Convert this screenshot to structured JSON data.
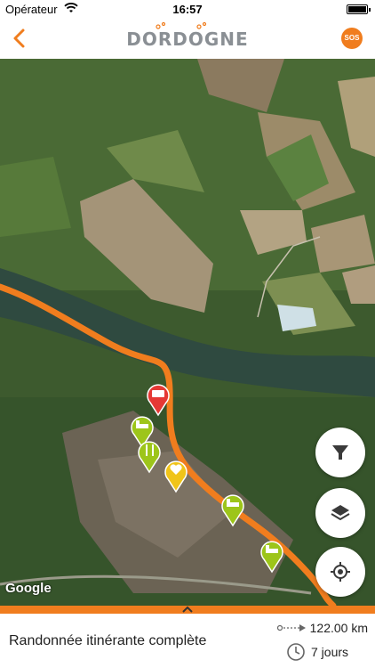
{
  "status_bar": {
    "carrier": "Opérateur",
    "time": "16:57"
  },
  "header": {
    "logo": "DORDOGNE",
    "sos_label": "SOS"
  },
  "map": {
    "attribution": "Google",
    "buttons": [
      "filter-icon",
      "layers-icon",
      "locate-icon"
    ]
  },
  "route": {
    "title": "Randonnée itinérante complète",
    "distance": "122.00 km",
    "duration": "7 jours"
  },
  "colors": {
    "accent": "#f07d1e",
    "poi_green": "#9dc51a",
    "poi_yellow": "#f0c419",
    "poi_red": "#e53935"
  }
}
